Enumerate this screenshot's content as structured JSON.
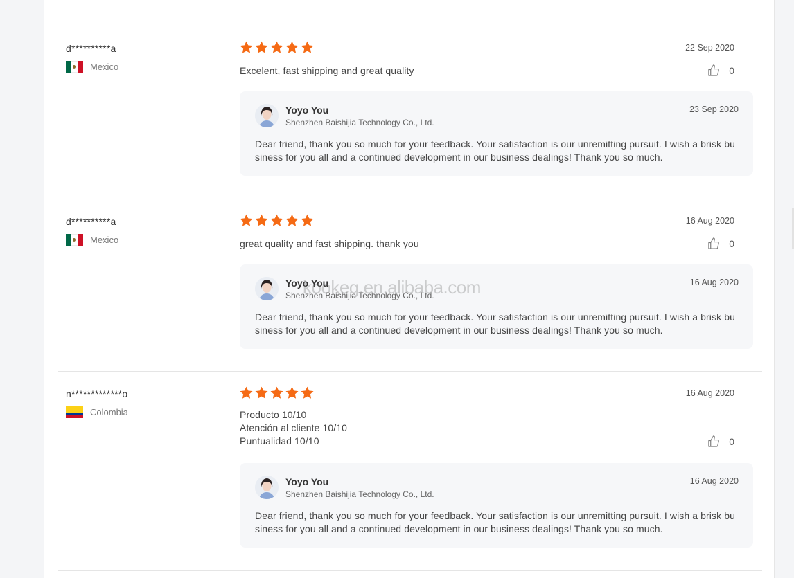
{
  "colors": {
    "star": "#f56a14",
    "panel": "#ffffff",
    "reply_bg": "#f6f7f9"
  },
  "reviews": [
    {
      "reviewer": "d**********a",
      "country": "Mexico",
      "flag": "mexico-flag",
      "rating": 5,
      "date": "22 Sep 2020",
      "text": [
        "Excelent, fast shipping and great quality"
      ],
      "likes": "0",
      "reply": {
        "name": "Yoyo You",
        "company": "Shenzhen Baishijia Technology Co., Ltd.",
        "date": "23 Sep 2020",
        "text": "Dear friend, thank you so much for your feedback. Your satisfaction is our unremitting pursuit. I wish a brisk business for you all and a continued development in our business dealings! Thank you so much."
      }
    },
    {
      "reviewer": "d**********a",
      "country": "Mexico",
      "flag": "mexico-flag",
      "rating": 5,
      "date": "16 Aug 2020",
      "text": [
        "great quality and fast shipping. thank you"
      ],
      "likes": "0",
      "reply": {
        "name": "Yoyo You",
        "company": "Shenzhen Baishijia Technology Co., Ltd.",
        "date": "16 Aug 2020",
        "text": "Dear friend, thank you so much for your feedback. Your satisfaction is our unremitting pursuit. I wish a brisk business for you all and a continued development in our business dealings! Thank you so much."
      }
    },
    {
      "reviewer": "n*************o",
      "country": "Colombia",
      "flag": "colombia-flag",
      "rating": 5,
      "date": "16 Aug 2020",
      "text": [
        "Producto 10/10",
        "Atención al cliente 10/10",
        "Puntualidad 10/10"
      ],
      "likes": "0",
      "reply": {
        "name": "Yoyo You",
        "company": "Shenzhen Baishijia Technology Co., Ltd.",
        "date": "16 Aug 2020",
        "text": "Dear friend, thank you so much for your feedback. Your satisfaction is our unremitting pursuit. I wish a brisk business for you all and a continued development in our business dealings! Thank you so much."
      }
    }
  ],
  "watermark": "kookeg.en.alibaba.com"
}
